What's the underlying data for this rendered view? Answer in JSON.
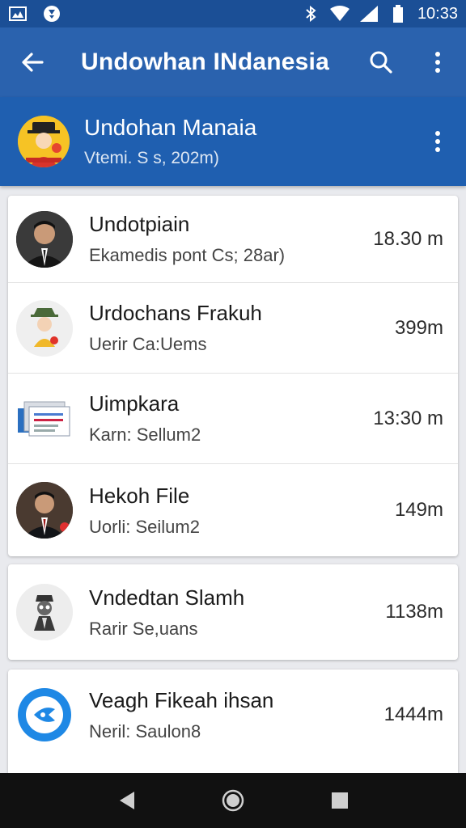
{
  "status_bar": {
    "time": "10:33",
    "icons": [
      "gallery-icon",
      "shield-icon",
      "bluetooth-icon",
      "wifi-icon",
      "signal-icon",
      "battery-icon"
    ]
  },
  "app_bar": {
    "title": "Undowhan INdanesia",
    "icons": [
      "back-arrow-icon",
      "search-icon",
      "more-vert-icon"
    ]
  },
  "channel": {
    "name": "Undohan Manaia",
    "subtitle": "Vtemi. S s, 202m)"
  },
  "list": [
    {
      "title": "Undotpiain",
      "subtitle": "Ekamedis pont Cs; 28ar)",
      "time": "18.30 m",
      "avatar": "man-suit-avatar"
    },
    {
      "title": "Urdochans Frakuh",
      "subtitle": "Uerir Ca:Uems",
      "time": "399m",
      "avatar": "cartoon-avatar"
    },
    {
      "title": "Uimpkara",
      "subtitle": "Karn: Sellum2",
      "time": "13:30 m",
      "avatar": "documents-icon"
    },
    {
      "title": "Hekoh File",
      "subtitle": "Uorli: Seilum2",
      "time": "149m",
      "avatar": "man-suit-avatar"
    },
    {
      "title": "Vndedtan Slamh",
      "subtitle": "Rarir Se,uans",
      "time": "1138m",
      "avatar": "hat-figure-avatar"
    },
    {
      "title": "Veagh Fikeah ihsan",
      "subtitle": "Neril: Saulon8",
      "time": "1444m",
      "avatar": "blue-circle-icon"
    }
  ],
  "colors": {
    "status_bar": "#1b4f96",
    "app_bar": "#2a62ae",
    "channel_header": "#1f5fb0",
    "background": "#e9eaee"
  }
}
